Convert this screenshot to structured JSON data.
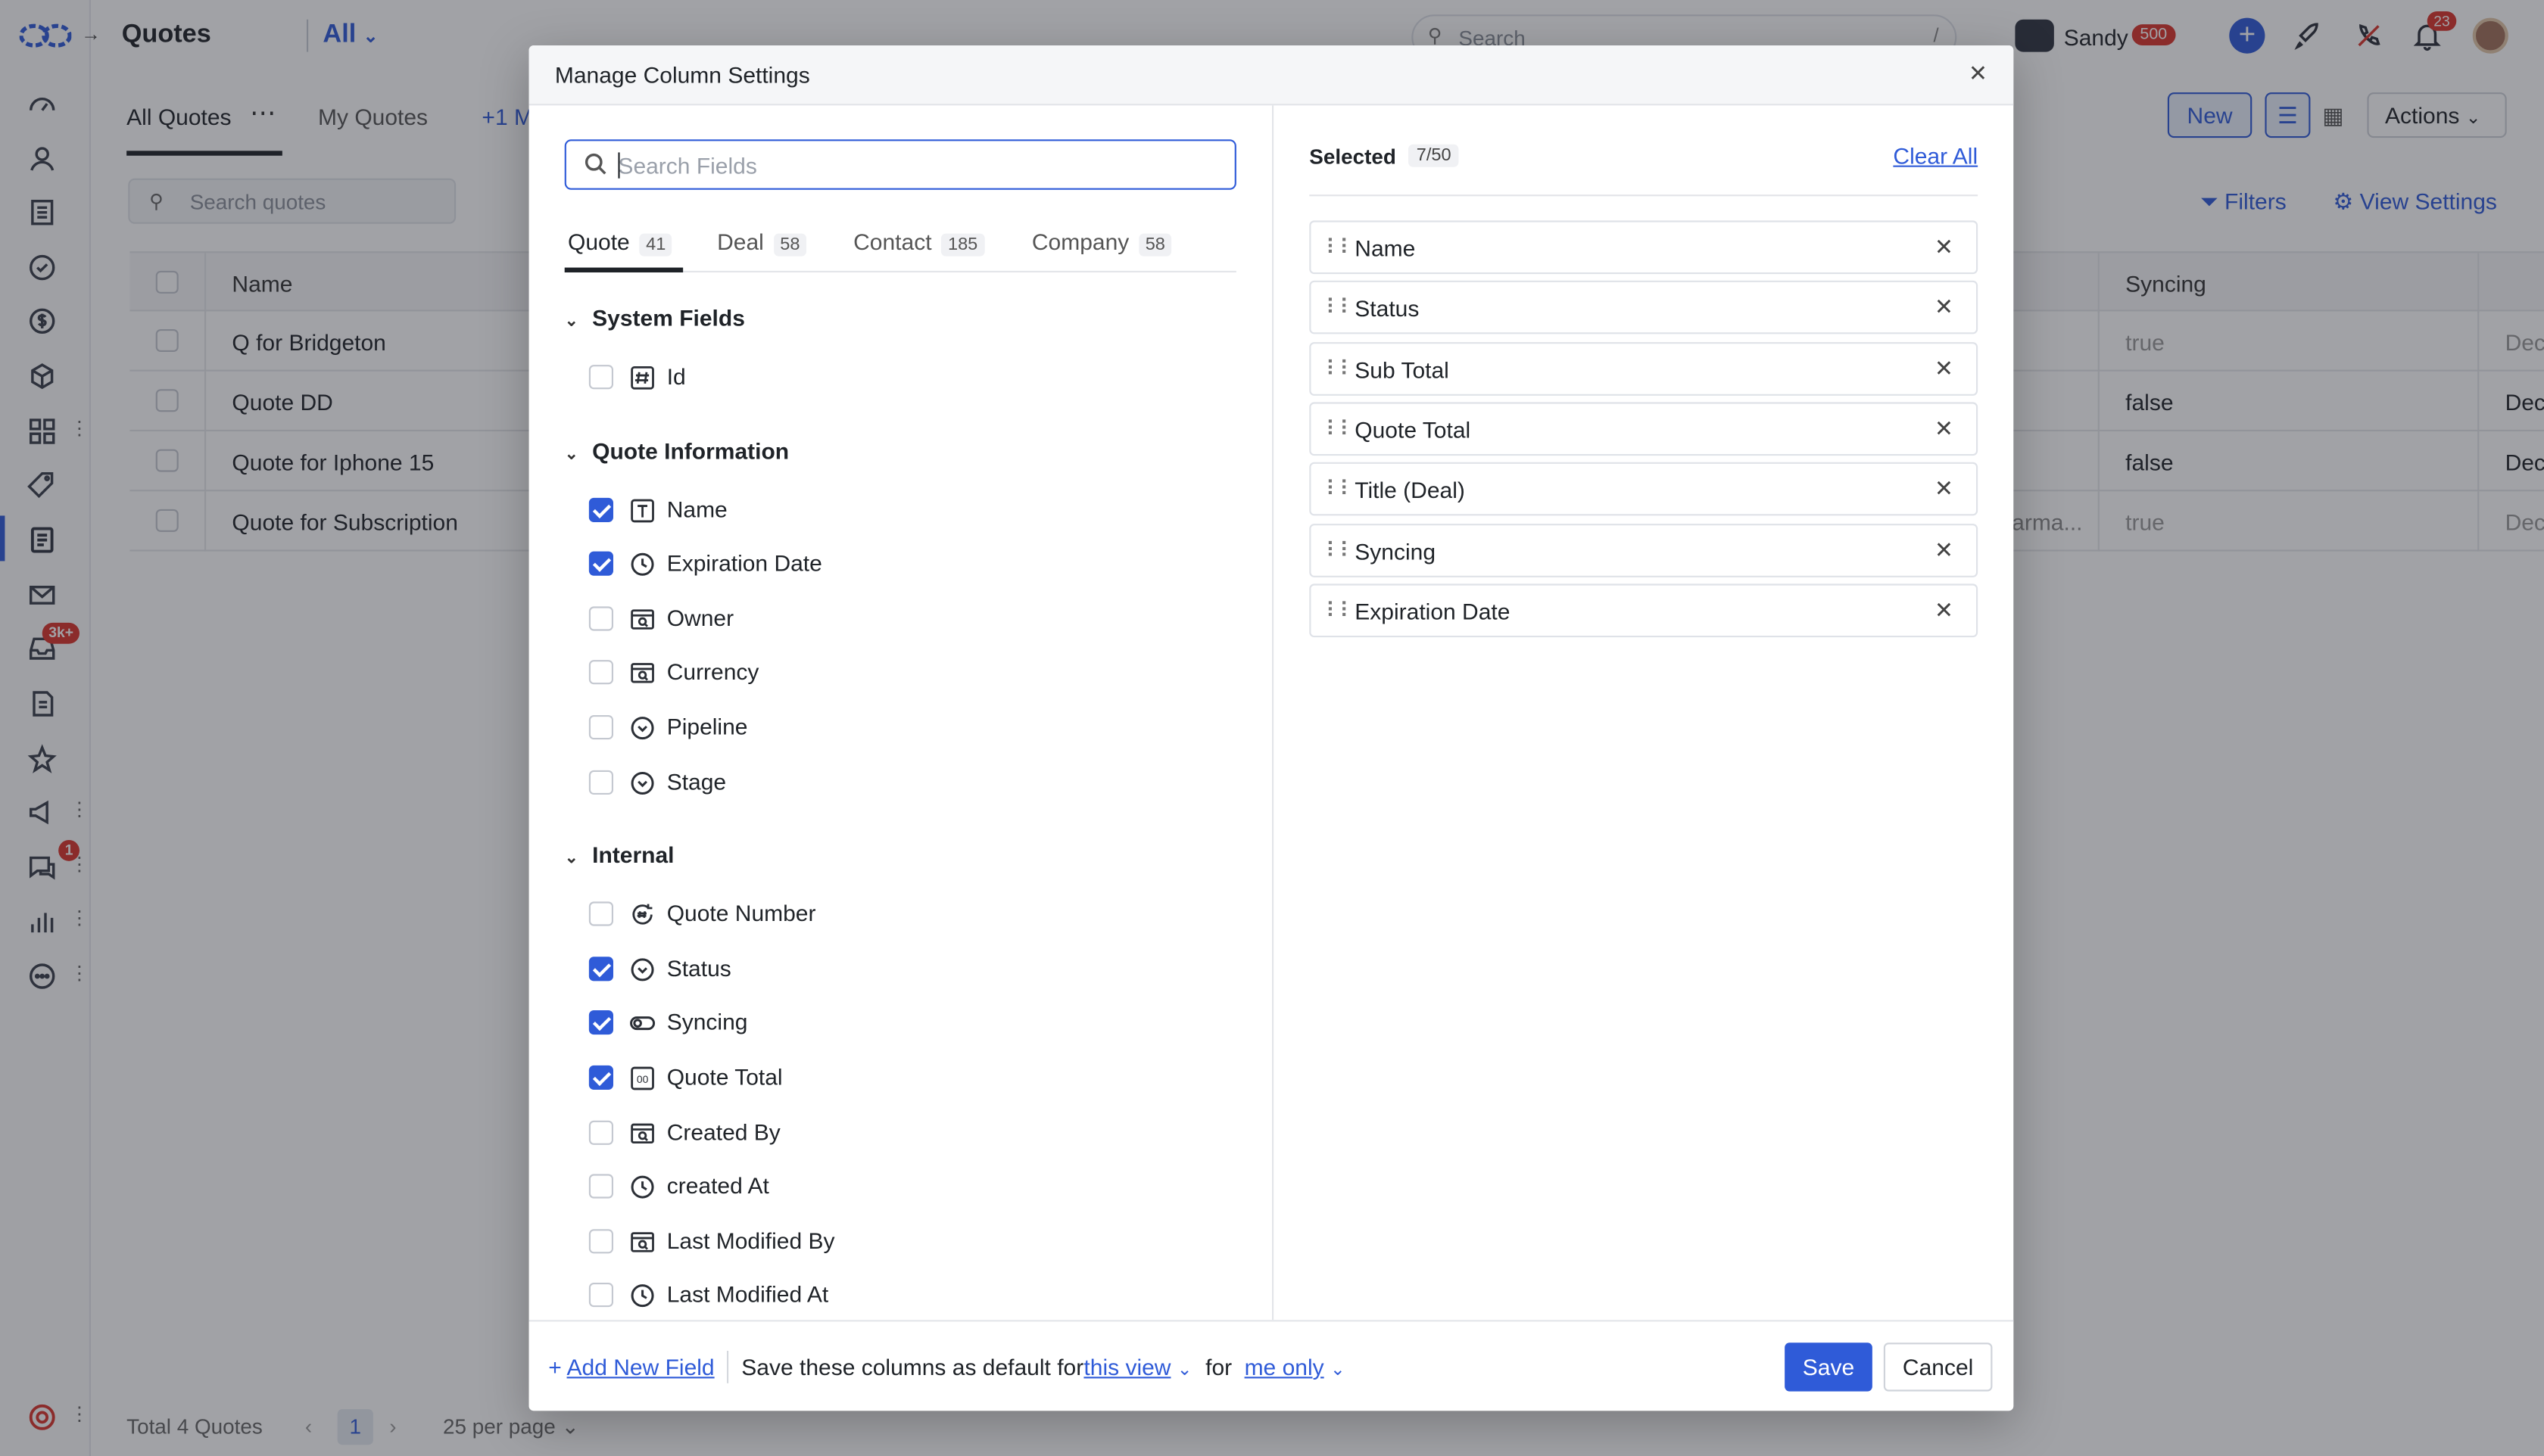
{
  "app": {
    "title": "Quotes",
    "view_selector": "All",
    "search_placeholder": "Search",
    "search_shortcut": "/",
    "user_name": "Sandy",
    "user_points": "500",
    "notifications_count": "23",
    "rail_badges": {
      "inbox": "3k+",
      "conversations": "1"
    }
  },
  "list": {
    "tabs": [
      "All Quotes",
      "My Quotes",
      "+1 M"
    ],
    "new_button": "New",
    "actions_button": "Actions",
    "search_placeholder": "Search quotes",
    "filters_label": "Filters",
    "view_settings_label": "View Settings",
    "columns": {
      "name": "Name",
      "syncing": "Syncing"
    },
    "rows": [
      {
        "name": "Q for Bridgeton",
        "extra": "",
        "syncing": "true",
        "date": "Dec"
      },
      {
        "name": "Quote DD",
        "extra": "",
        "syncing": "false",
        "date": "Dec"
      },
      {
        "name": "Quote for Iphone 15",
        "extra": "",
        "syncing": "false",
        "date": "Dec"
      },
      {
        "name": "Quote for Subscription",
        "extra": "arma...",
        "syncing": "true",
        "date": "Dec"
      }
    ],
    "footer_total": "Total 4 Quotes",
    "current_page": "1",
    "per_page": "25 per page"
  },
  "modal": {
    "title": "Manage Column Settings",
    "search_placeholder": "Search Fields",
    "search_value": "",
    "tabs": [
      {
        "label": "Quote",
        "count": "41"
      },
      {
        "label": "Deal",
        "count": "58"
      },
      {
        "label": "Contact",
        "count": "185"
      },
      {
        "label": "Company",
        "count": "58"
      }
    ],
    "sections": [
      {
        "title": "System Fields",
        "fields": [
          {
            "label": "Id",
            "icon": "hash-icon",
            "checked": false
          }
        ]
      },
      {
        "title": "Quote Information",
        "fields": [
          {
            "label": "Name",
            "icon": "text-icon",
            "checked": true
          },
          {
            "label": "Expiration Date",
            "icon": "clock-icon",
            "checked": true
          },
          {
            "label": "Owner",
            "icon": "lookup-icon",
            "checked": false
          },
          {
            "label": "Currency",
            "icon": "lookup-icon",
            "checked": false
          },
          {
            "label": "Pipeline",
            "icon": "select-icon",
            "checked": false
          },
          {
            "label": "Stage",
            "icon": "select-icon",
            "checked": false
          }
        ]
      },
      {
        "title": "Internal",
        "fields": [
          {
            "label": "Quote Number",
            "icon": "autonumber-icon",
            "checked": false
          },
          {
            "label": "Status",
            "icon": "select-icon",
            "checked": true
          },
          {
            "label": "Syncing",
            "icon": "toggle-icon",
            "checked": true
          },
          {
            "label": "Quote Total",
            "icon": "currency-icon",
            "checked": true
          },
          {
            "label": "Created By",
            "icon": "lookup-icon",
            "checked": false
          },
          {
            "label": "created At",
            "icon": "clock-icon",
            "checked": false
          },
          {
            "label": "Last Modified By",
            "icon": "lookup-icon",
            "checked": false
          },
          {
            "label": "Last Modified At",
            "icon": "clock-icon",
            "checked": false
          }
        ]
      }
    ],
    "selected_label": "Selected",
    "selected_count": "7/50",
    "clear_all": "Clear All",
    "selected": [
      "Name",
      "Status",
      "Sub Total",
      "Quote Total",
      "Title (Deal)",
      "Syncing",
      "Expiration Date"
    ],
    "footer": {
      "add_field": "Add New Field",
      "save_text": "Save these columns as default for",
      "view_option": "this view",
      "for_text": "for",
      "who_option": "me only",
      "save_button": "Save",
      "cancel_button": "Cancel"
    }
  },
  "colors": {
    "accent": "#2f5bd8",
    "badge": "#d9342b",
    "overlay": "rgba(30,34,42,0.42)"
  }
}
